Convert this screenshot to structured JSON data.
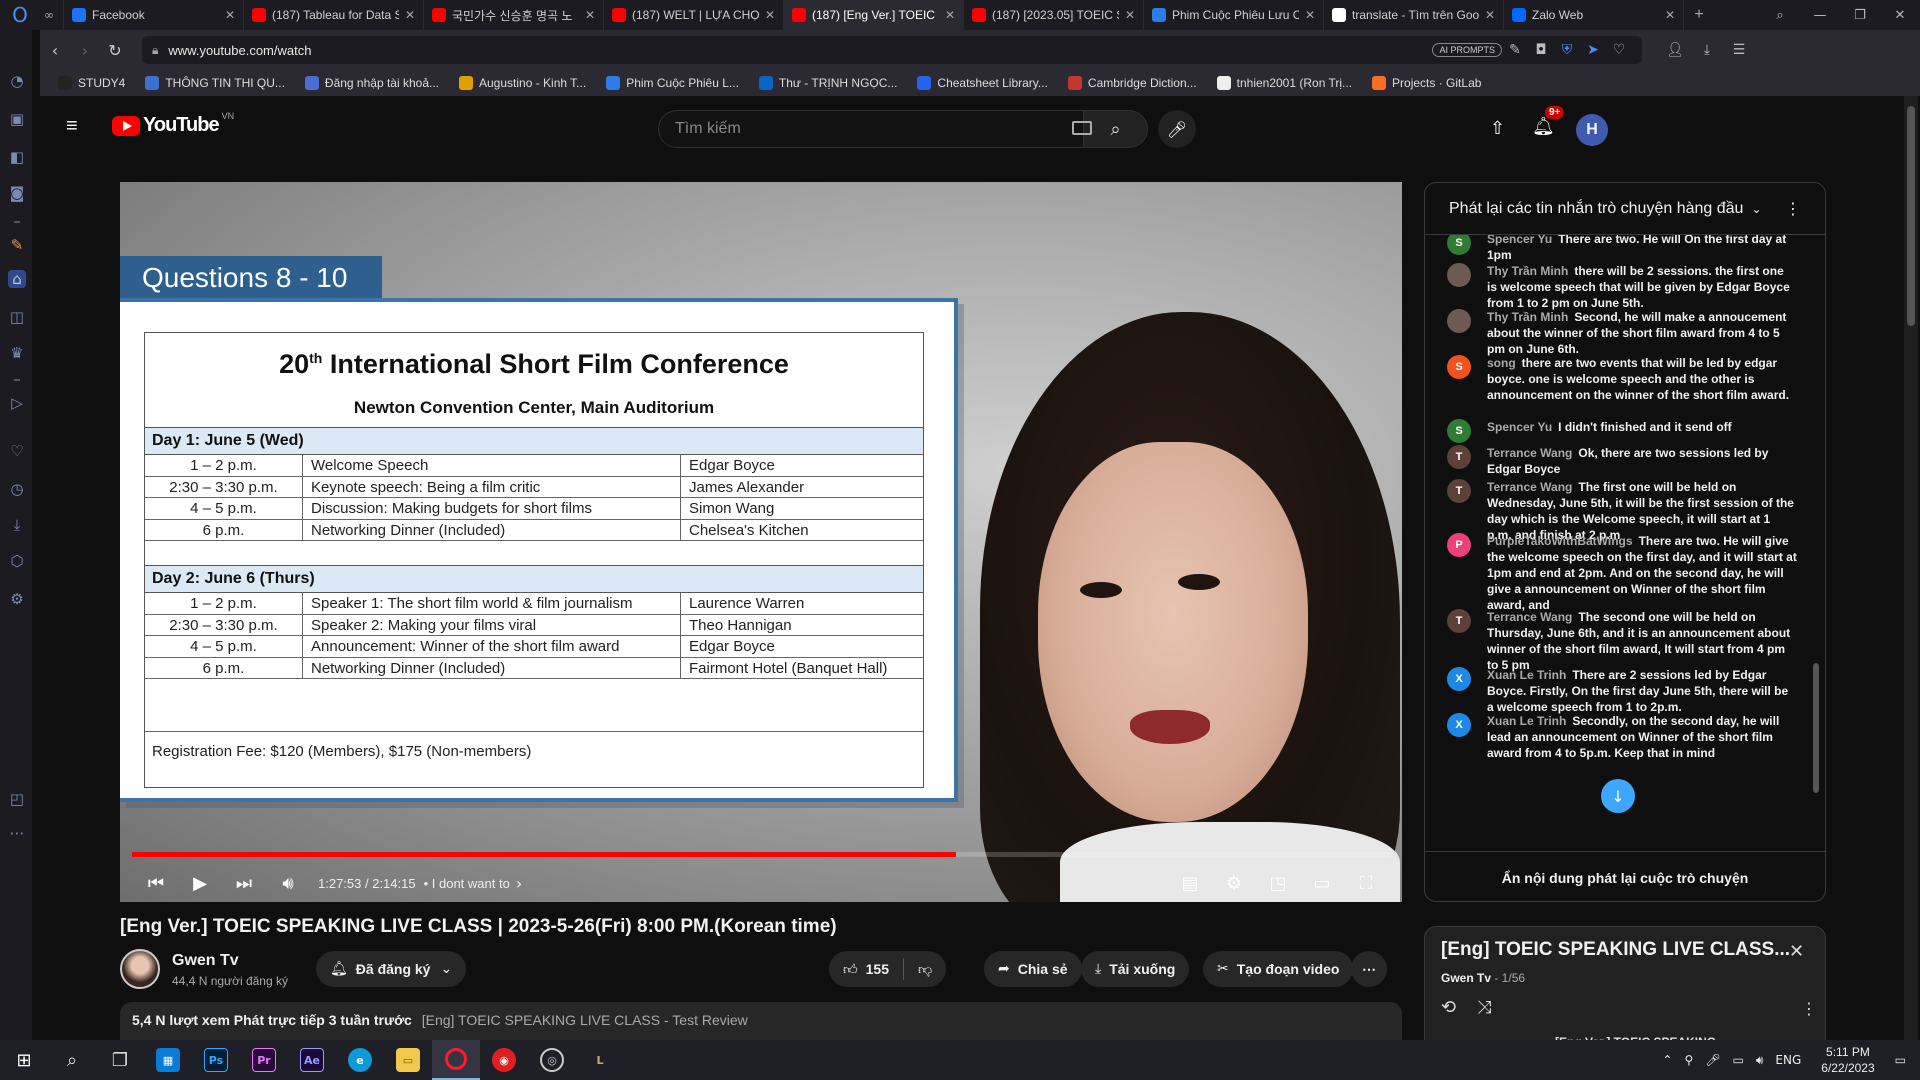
{
  "browser": {
    "tabs": [
      {
        "title": "Facebook",
        "favicon": "facebook-icon",
        "color": "#1877f2",
        "active": false
      },
      {
        "title": "(187) Tableau for Data S",
        "favicon": "youtube-icon",
        "color": "#ff0000",
        "active": false
      },
      {
        "title": "국민가수 신승훈 명곡 노",
        "favicon": "youtube-icon",
        "color": "#ff0000",
        "active": false
      },
      {
        "title": "(187) WELT | LỰA CHỌN",
        "favicon": "youtube-icon",
        "color": "#ff0000",
        "active": false
      },
      {
        "title": "(187) [Eng Ver.] TOEIC S",
        "favicon": "youtube-icon",
        "color": "#ff0000",
        "active": true
      },
      {
        "title": "(187) [2023.05] TOEIC S",
        "favicon": "youtube-icon",
        "color": "#ff0000",
        "active": false
      },
      {
        "title": "Phim Cuộc Phiêu Lưu C",
        "favicon": "globe-icon",
        "color": "#2b7de9",
        "active": false
      },
      {
        "title": "translate - Tìm trên Goo",
        "favicon": "google-icon",
        "color": "#ffffff",
        "active": false
      },
      {
        "title": "Zalo Web",
        "favicon": "zalo-icon",
        "color": "#0068ff",
        "active": false
      }
    ],
    "url": "www.youtube.com/watch",
    "ai_badge": "AI PROMPTS",
    "bookmarks": [
      {
        "label": "STUDY4",
        "color": "#222"
      },
      {
        "label": "THÔNG TIN THI QU...",
        "color": "#3b6fd6"
      },
      {
        "label": "Đăng nhập tài khoả...",
        "color": "#4a6ed6"
      },
      {
        "label": "Augustino - Kinh T...",
        "color": "#e0a000"
      },
      {
        "label": "Phim Cuộc Phiêu L...",
        "color": "#2b7de9"
      },
      {
        "label": "Thư - TRỊNH NGỌC...",
        "color": "#0a64c8"
      },
      {
        "label": "Cheatsheet Library...",
        "color": "#2563eb"
      },
      {
        "label": "Cambridge Diction...",
        "color": "#c0392b"
      },
      {
        "label": "tnhien2001 (Ron Trị...",
        "color": "#eeeeee"
      },
      {
        "label": "Projects · GitLab",
        "color": "#fc6d26"
      }
    ]
  },
  "youtube": {
    "logo_text": "YouTube",
    "country": "VN",
    "search_placeholder": "Tìm kiếm",
    "notif_count": "9+",
    "avatar_letter": "H"
  },
  "slide": {
    "label": "Questions 8 - 10",
    "title_num": "20",
    "title_sup": "th",
    "title_rest": "International Short Film Conference",
    "subtitle": "Newton Convention Center, Main Auditorium",
    "day1": "Day 1: June 5 (Wed)",
    "day1_rows": [
      [
        "1 – 2 p.m.",
        "Welcome Speech",
        "Edgar Boyce"
      ],
      [
        "2:30 – 3:30 p.m.",
        "Keynote speech: Being a film critic",
        "James Alexander"
      ],
      [
        "4 – 5 p.m.",
        "Discussion: Making budgets for short films",
        "Simon Wang"
      ],
      [
        "6 p.m.",
        "Networking Dinner (Included)",
        "Chelsea's Kitchen"
      ]
    ],
    "day2": "Day 2: June 6 (Thurs)",
    "day2_rows": [
      [
        "1 – 2 p.m.",
        "Speaker 1: The short film world & film journalism",
        "Laurence Warren"
      ],
      [
        "2:30 – 3:30 p.m.",
        "Speaker 2: Making your films viral",
        "Theo Hannigan"
      ],
      [
        "4 – 5 p.m.",
        "Announcement: Winner of the short film award",
        "Edgar Boyce"
      ],
      [
        "6 p.m.",
        "Networking Dinner (Included)",
        "Fairmont Hotel (Banquet Hall)"
      ]
    ],
    "fee": "Registration Fee: $120 (Members), $175 (Non-members)"
  },
  "player": {
    "time": "1:27:53 / 2:14:15",
    "chapter": "• I dont want to",
    "played_fraction": 0.655,
    "loaded_fraction": 0.655
  },
  "video": {
    "title": "[Eng Ver.] TOEIC SPEAKING LIVE CLASS | 2023-5-26(Fri) 8:00 PM.(Korean time)",
    "channel": "Gwen Tv",
    "subscribers": "44,4 N người đăng ký",
    "subscribed_label": "Đã đăng ký",
    "likes": "155",
    "share_label": "Chia sẻ",
    "download_label": "Tải xuống",
    "clip_label": "Tạo đoạn video",
    "views_meta": "5,4 N lượt xem  Phát trực tiếp 3 tuần trước",
    "desc_snippet": "[Eng] TOEIC SPEAKING LIVE CLASS - Test Review"
  },
  "chat": {
    "header": "Phát lại các tin nhắn trò chuyện hàng đầu",
    "footer": "Ẩn nội dung phát lại cuộc trò chuyện",
    "messages": [
      {
        "author": "Spencer Yu",
        "text": "There are two. He will On the first day at 1pm",
        "letter": "S",
        "color": "#2e7d32"
      },
      {
        "author": "Thy Trần Minh",
        "text": "there will be 2 sessions. the first one is welcome speech that will be given by Edgar Boyce from 1 to 2 pm on June 5th.",
        "letter": "",
        "color": "#6d5a52"
      },
      {
        "author": "Thy Trần Minh",
        "text": "Second, he will make a annoucement about the winner of the short film award from 4 to 5 pm on June 6th.",
        "letter": "",
        "color": "#6d5a52"
      },
      {
        "author": "song",
        "text": "there are two events that will be led by edgar boyce. one is welcome speech and the other is announcement on the winner of the short film award.",
        "letter": "S",
        "color": "#f4511e"
      },
      {
        "author": "Spencer Yu",
        "text": "I didn't finished and it send off",
        "letter": "S",
        "color": "#2e7d32"
      },
      {
        "author": "Terrance Wang",
        "text": "Ok, there are two sessions led by Edgar Boyce",
        "letter": "T",
        "color": "#5d4037"
      },
      {
        "author": "Terrance Wang",
        "text": "The first one will be held on Wednesday, June 5th, it will be the first session of the day which is the Welcome speech, it will start at 1 p.m. and finish at 2 p.m",
        "letter": "T",
        "color": "#5d4037"
      },
      {
        "author": "PurpleTakoWithBatWings",
        "text": "There are two. He will give the welcome speech on the first day, and it will start at 1pm and end at 2pm. And on the second day, he will give a announcement on Winner of the short film award, and",
        "letter": "P",
        "color": "#ec407a"
      },
      {
        "author": "Terrance Wang",
        "text": "The second one will be held on Thursday, June 6th, and it is an announcement about winner of the short film award, It will start from 4 pm to 5 pm",
        "letter": "T",
        "color": "#5d4037"
      },
      {
        "author": "Xuan Le Trinh",
        "text": "There are 2 sessions led by Edgar Boyce. Firstly, On the first day June 5th, there will be a welcome speech from 1 to 2p.m.",
        "letter": "X",
        "color": "#1e88e5"
      },
      {
        "author": "Xuan Le Trinh",
        "text": "Secondly, on the second day, he will lead an announcement on Winner of the short film award from 4 to 5p.m. Keep that in mind",
        "letter": "X",
        "color": "#1e88e5"
      }
    ]
  },
  "playlist": {
    "title": "[Eng] TOEIC SPEAKING LIVE CLASS...",
    "channel": "Gwen Tv",
    "position": " - 1/56",
    "next_item": "[Eng Ver.] TOEIC SPEAKING"
  },
  "taskbar": {
    "lang": "ENG",
    "time": "5:11 PM",
    "date": "6/22/2023"
  }
}
